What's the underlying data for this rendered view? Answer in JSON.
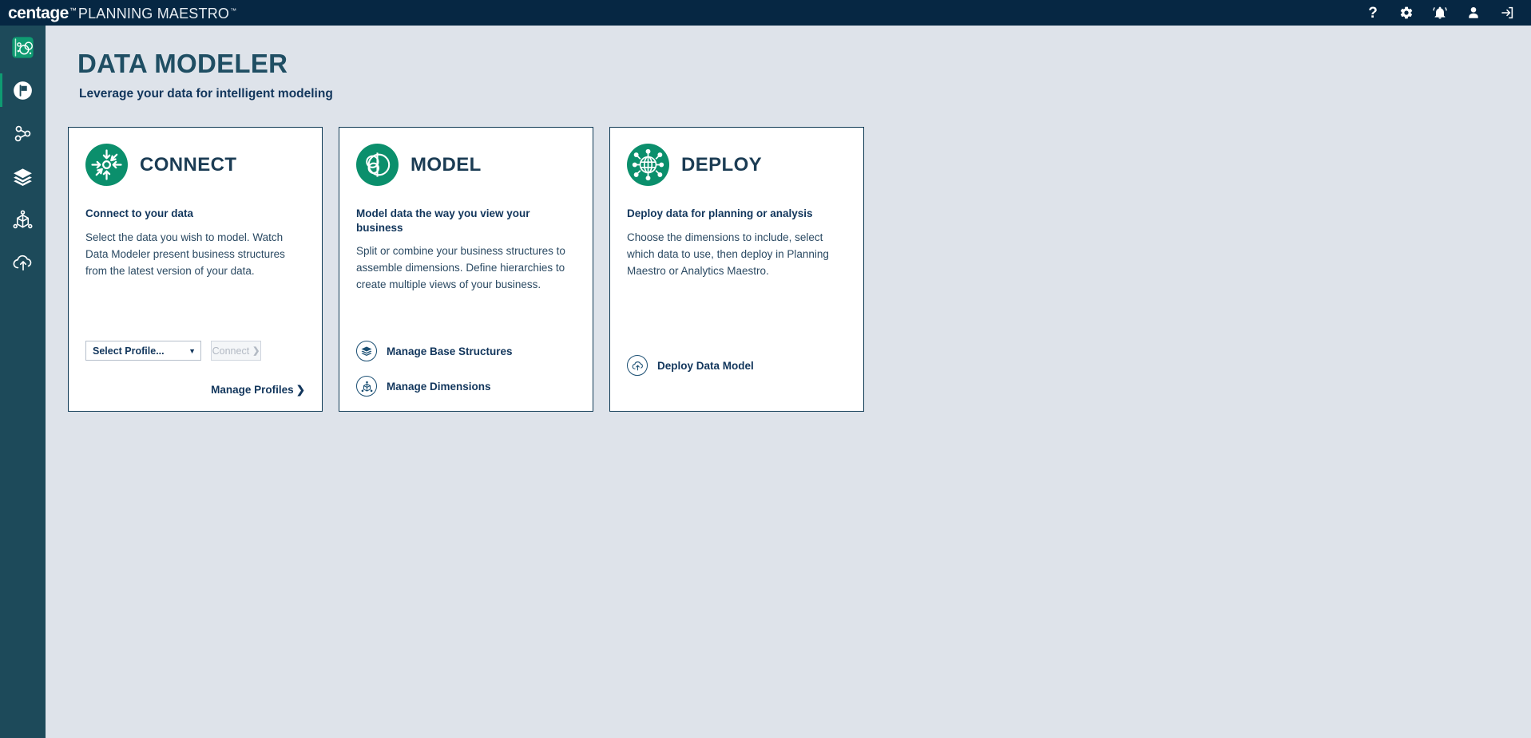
{
  "topbar": {
    "brand_name": "centage",
    "brand_tm": "™",
    "product_name": "PLANNING MAESTRO",
    "product_tm": "™",
    "icons": [
      {
        "name": "help-icon",
        "glyph": "?",
        "label": "Help"
      },
      {
        "name": "gear-icon",
        "label": "Settings"
      },
      {
        "name": "bell-icon",
        "label": "Notifications"
      },
      {
        "name": "user-icon",
        "label": "Account"
      },
      {
        "name": "logout-icon",
        "label": "Sign out"
      }
    ]
  },
  "sidebar": {
    "items": [
      {
        "name": "sidebar-item-data-modeler",
        "icon": "data-bubbles-icon",
        "label": "Data Modeler",
        "active": true
      },
      {
        "name": "sidebar-item-plan",
        "icon": "flag-circle-icon",
        "label": "Plan",
        "active": false
      },
      {
        "name": "sidebar-item-connections",
        "icon": "share-nodes-icon",
        "label": "Connections",
        "active": false
      },
      {
        "name": "sidebar-item-structures",
        "icon": "layers-icon",
        "label": "Base Structures",
        "active": false
      },
      {
        "name": "sidebar-item-dimensions",
        "icon": "cube-nodes-icon",
        "label": "Dimensions",
        "active": false
      },
      {
        "name": "sidebar-item-deploy",
        "icon": "cloud-upload-icon",
        "label": "Deploy",
        "active": false
      }
    ]
  },
  "page": {
    "title": "DATA MODELER",
    "subtitle": "Leverage your data for intelligent modeling"
  },
  "cards": {
    "connect": {
      "title": "CONNECT",
      "badge_icon": "connect-arrows-icon",
      "lead": "Connect to your data",
      "body": "Select the data you wish to model. Watch Data Modeler present business structures from the latest version of your data.",
      "select_value": "Select Profile...",
      "select_caret": "▼",
      "button_label": "Connect",
      "button_chevron": "❯",
      "manage_link": "Manage Profiles",
      "manage_chevron": "❯"
    },
    "model": {
      "title": "MODEL",
      "badge_icon": "model-circles-icon",
      "lead": "Model data the way you view your business",
      "body": "Split or combine your business structures to assemble dimensions. Define hierarchies to create multiple views of your business.",
      "links": [
        {
          "name": "link-manage-base-structures",
          "icon": "layers-icon",
          "label": "Manage Base Structures"
        },
        {
          "name": "link-manage-dimensions",
          "icon": "cube-nodes-icon",
          "label": "Manage Dimensions"
        }
      ]
    },
    "deploy": {
      "title": "DEPLOY",
      "badge_icon": "globe-network-icon",
      "lead": "Deploy data for planning or analysis",
      "body": "Choose the dimensions to include, select which data to use, then deploy in Planning Maestro or Analytics Maestro.",
      "links": [
        {
          "name": "link-deploy-data-model",
          "icon": "cloud-upload-icon",
          "label": "Deploy Data Model"
        }
      ]
    }
  },
  "colors": {
    "topbar_bg": "#062743",
    "rail_bg": "#1d4a5a",
    "page_bg": "#dee3ea",
    "accent_green": "#0b8f6c",
    "rail_accent": "#0f9b72",
    "title_blue": "#1f4e63",
    "text_navy": "#12365c",
    "card_border": "#0f3a55"
  }
}
